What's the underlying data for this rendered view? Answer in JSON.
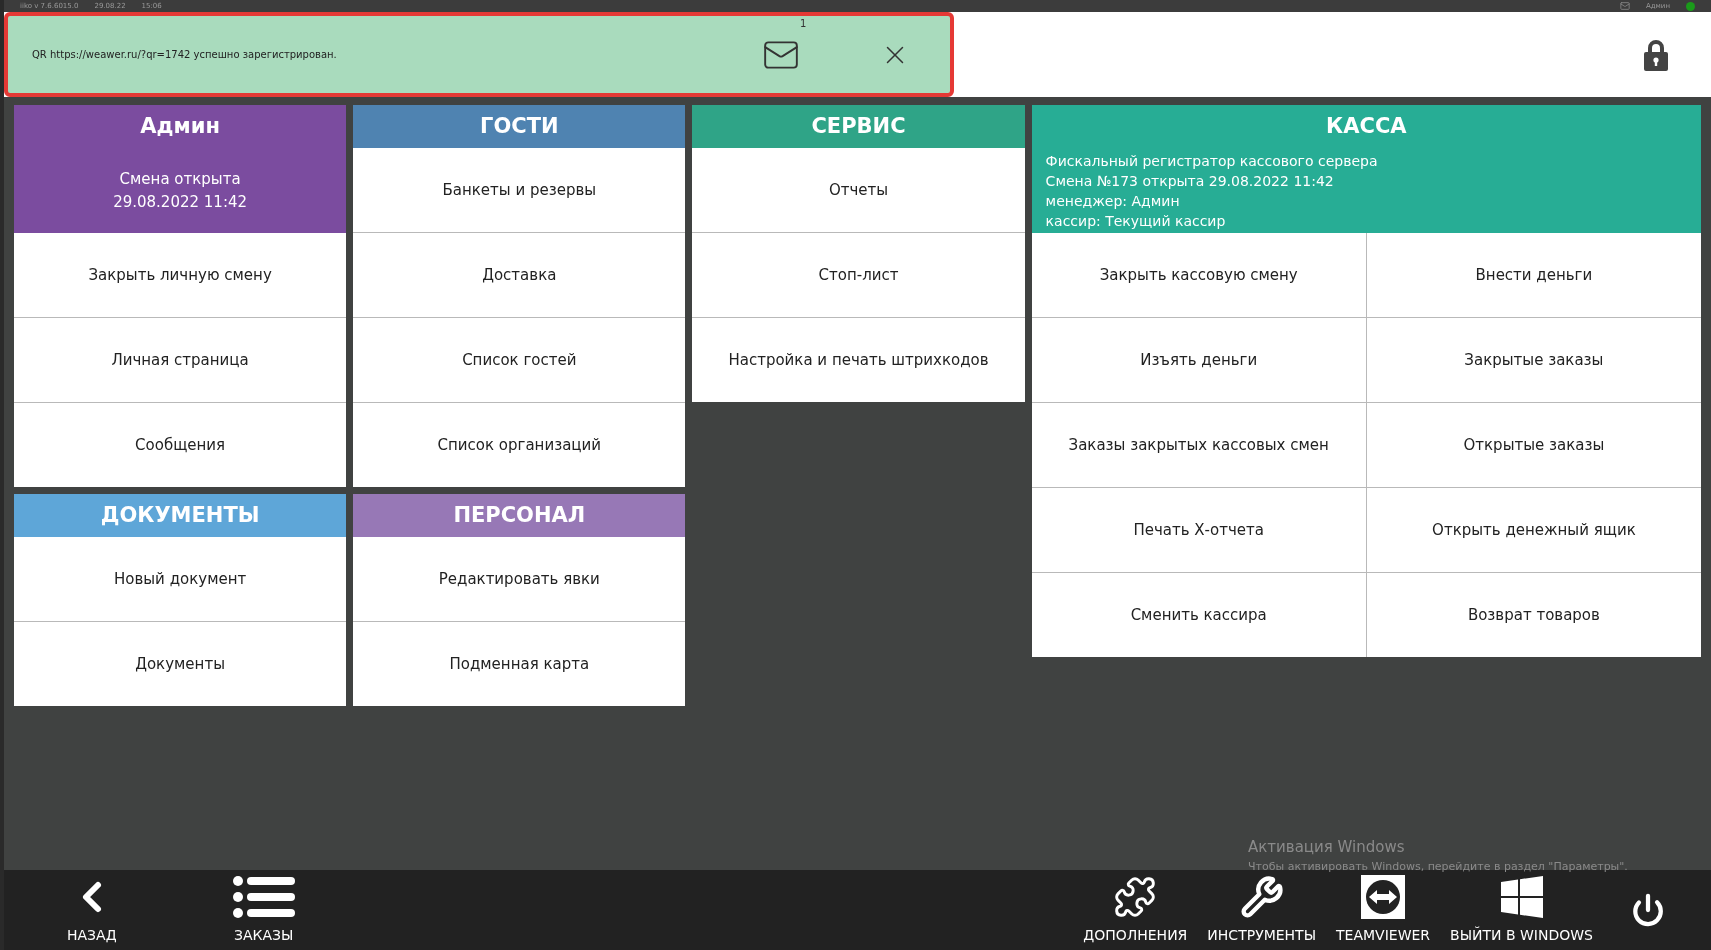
{
  "title_bar": {
    "version": "iiko v 7.6.6015.0",
    "date": "29.08.22",
    "time": "15:06",
    "user": "Админ",
    "online": true
  },
  "notification": {
    "text": "QR https://weawer.ru/?qr=1742 успешно зарегистрирован.",
    "count": "1"
  },
  "columns": [
    [
      {
        "title": "Админ",
        "color": "#7b4c9f",
        "kind": "single",
        "info": [
          "Смена открыта",
          "29.08.2022 11:42"
        ],
        "buttons": [
          "Закрыть личную смену",
          "Личная страница",
          "Сообщения"
        ]
      },
      {
        "title": "ДОКУМЕНТЫ",
        "color": "#5ea6d8",
        "kind": "single",
        "buttons": [
          "Новый документ",
          "Документы"
        ]
      }
    ],
    [
      {
        "title": "ГОСТИ",
        "color": "#4f83b1",
        "kind": "single",
        "buttons": [
          "Банкеты и резервы",
          "Доставка",
          "Список гостей",
          "Список организаций"
        ]
      },
      {
        "title": "ПЕРСОНАЛ",
        "color": "#9778b6",
        "kind": "single",
        "buttons": [
          "Редактировать явки",
          "Подменная карта"
        ]
      }
    ],
    [
      {
        "title": "СЕРВИС",
        "color": "#2fa487",
        "kind": "single",
        "buttons": [
          "Отчеты",
          "Стоп-лист",
          "Настройка и печать штрихкодов"
        ]
      }
    ],
    [
      {
        "title": "КАССА",
        "color": "#27ad95",
        "kind": "double",
        "info": [
          "Фискальный регистратор кассового сервера",
          "Смена №173 открыта 29.08.2022 11:42",
          "менеджер: Админ",
          "кассир: Текущий кассир"
        ],
        "buttons": [
          "Закрыть кассовую смену",
          "Внести деньги",
          "Изъять деньги",
          "Закрытые заказы",
          "Заказы закрытых кассовых смен",
          "Открытые заказы",
          "Печать Х-отчета",
          "Открыть денежный ящик",
          "Сменить кассира",
          "Возврат товаров"
        ]
      }
    ]
  ],
  "activation": {
    "title": "Активация Windows",
    "text": "Чтобы активировать Windows, перейдите в раздел \"Параметры\"."
  },
  "bottom_left": [
    {
      "kind": "back",
      "label": "НАЗАД"
    },
    {
      "kind": "orders",
      "label": "ЗАКАЗЫ"
    }
  ],
  "bottom_right": [
    {
      "kind": "addons",
      "label": "ДОПОЛНЕНИЯ"
    },
    {
      "kind": "tools",
      "label": "ИНСТРУМЕНТЫ"
    },
    {
      "kind": "teamviewer",
      "label": "TEAMVIEWER"
    },
    {
      "kind": "windows",
      "label": "ВЫЙТИ В WINDOWS"
    }
  ]
}
